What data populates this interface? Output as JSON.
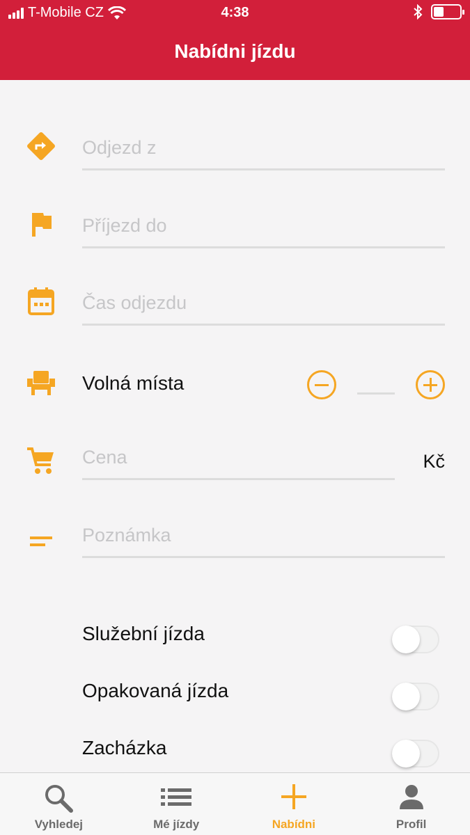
{
  "status": {
    "carrier": "T-Mobile CZ",
    "time": "4:38",
    "battery_level": 0.4
  },
  "header": {
    "title": "Nabídni jízdu"
  },
  "form": {
    "from_placeholder": "Odjezd z",
    "to_placeholder": "Příjezd do",
    "time_placeholder": "Čas odjezdu",
    "seats_label": "Volná místa",
    "seats_value": "",
    "price_placeholder": "Cena",
    "currency": "Kč",
    "note_placeholder": "Poznámka"
  },
  "toggles": [
    {
      "label": "Služební jízda",
      "on": false
    },
    {
      "label": "Opakovaná jízda",
      "on": false
    },
    {
      "label": "Zacházka",
      "on": false
    }
  ],
  "tabs": [
    {
      "label": "Vyhledej",
      "icon": "search-icon"
    },
    {
      "label": "Mé jízdy",
      "icon": "list-icon"
    },
    {
      "label": "Nabídni",
      "icon": "plus-icon",
      "active": true
    },
    {
      "label": "Profil",
      "icon": "person-icon"
    }
  ],
  "colors": {
    "brand_red": "#d21f3a",
    "accent_orange": "#f5a623"
  }
}
